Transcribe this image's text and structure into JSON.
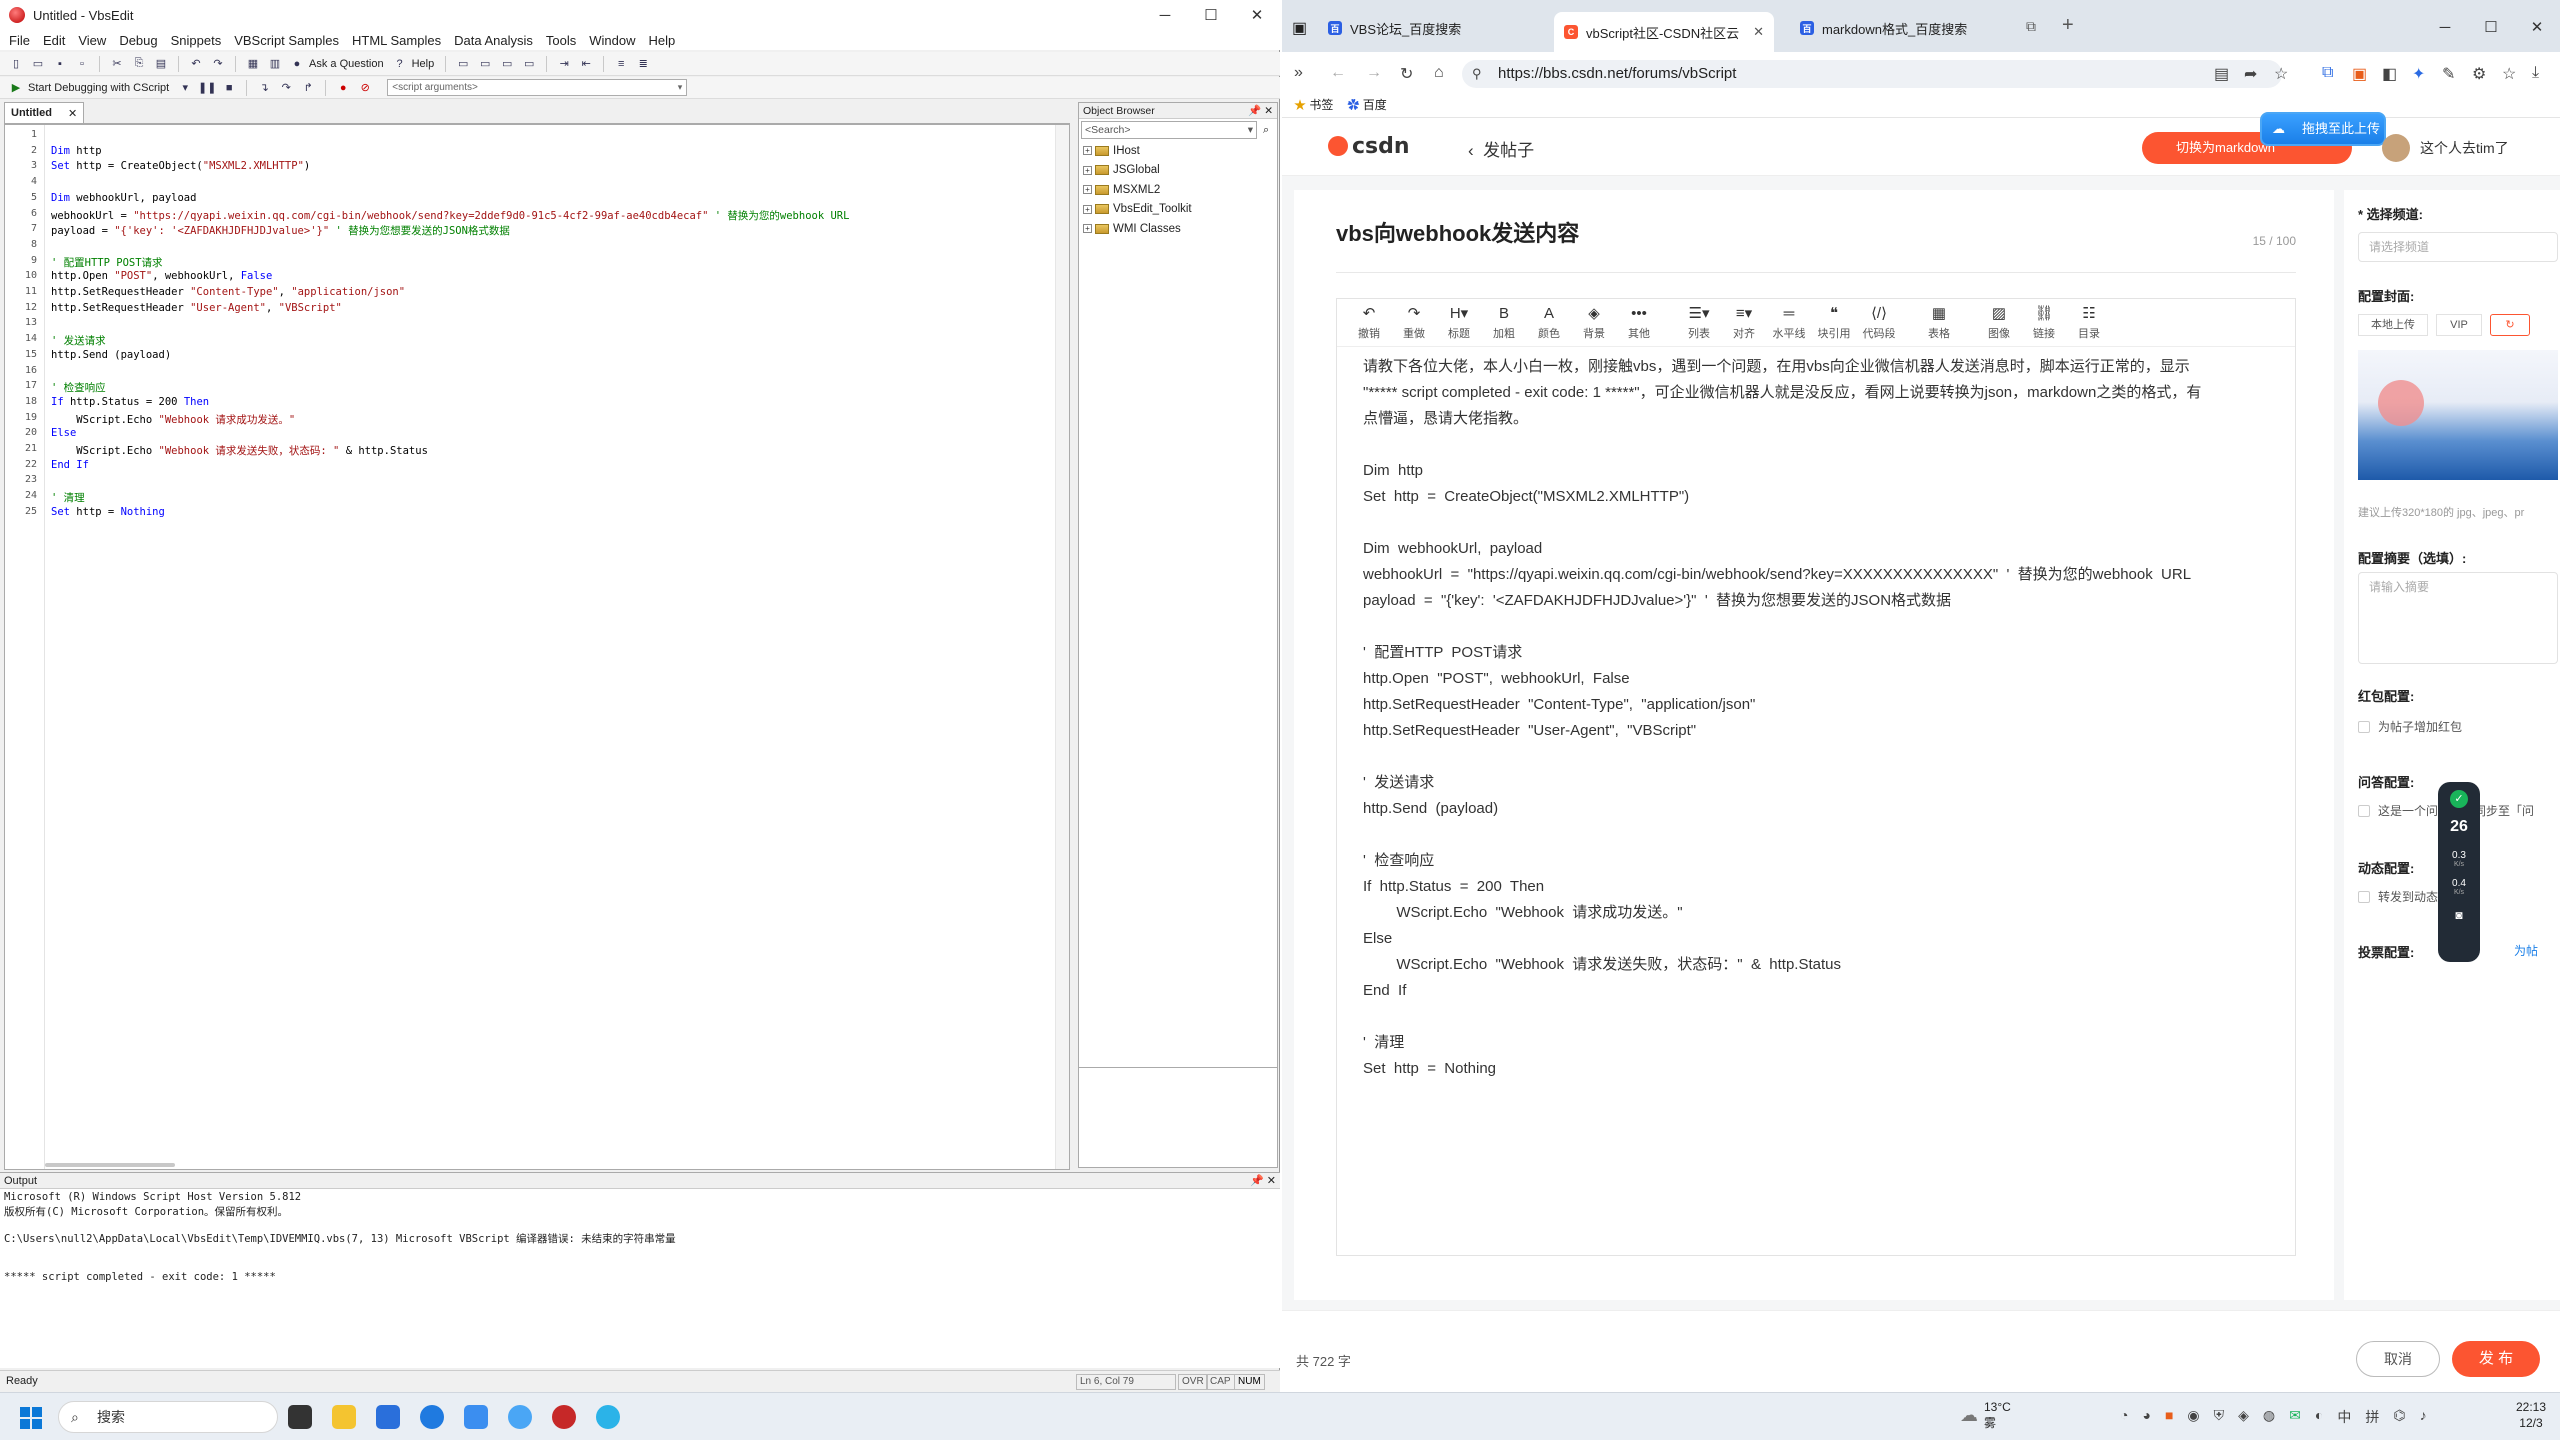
{
  "vbsedit": {
    "window_title": "Untitled - VbsEdit",
    "menu": [
      "File",
      "Edit",
      "View",
      "Debug",
      "Snippets",
      "VBScript Samples",
      "HTML Samples",
      "Data Analysis",
      "Tools",
      "Window",
      "Help"
    ],
    "toolbar": {
      "ask": "Ask a Question",
      "help": "Help",
      "debug": "Start Debugging with CScript",
      "args_placeholder": "<script arguments>"
    },
    "doc_tab": "Untitled",
    "code_lines": [
      "",
      "Dim http",
      "Set http = CreateObject(\"MSXML2.XMLHTTP\")",
      "",
      "Dim webhookUrl, payload",
      "webhookUrl = \"https://qyapi.weixin.qq.com/cgi-bin/webhook/send?key=2ddef9d0-91c5-4cf2-99af-ae40cdb4ecaf\" ' 替换为您的webhook URL",
      "payload = \"{'key': '<ZAFDAKHJDFHJDJvalue>'}\" ' 替换为您想要发送的JSON格式数据",
      "",
      "' 配置HTTP POST请求",
      "http.Open \"POST\", webhookUrl, False",
      "http.SetRequestHeader \"Content-Type\", \"application/json\"",
      "http.SetRequestHeader \"User-Agent\", \"VBScript\"",
      "",
      "' 发送请求",
      "http.Send (payload)",
      "",
      "' 检查响应",
      "If http.Status = 200 Then",
      "    WScript.Echo \"Webhook 请求成功发送。\"",
      "Else",
      "    WScript.Echo \"Webhook 请求发送失败，状态码: \" & http.Status",
      "End If",
      "",
      "' 清理",
      "Set http = Nothing"
    ],
    "object_browser": {
      "title": "Object Browser",
      "search": "<Search>",
      "items": [
        "IHost",
        "JSGlobal",
        "MSXML2",
        "VbsEdit_Toolkit",
        "WMI Classes"
      ]
    },
    "output": {
      "title": "Output",
      "lines": [
        "Microsoft (R) Windows Script Host Version 5.812",
        "版权所有(C) Microsoft Corporation。保留所有权利。",
        "",
        "C:\\Users\\null2\\AppData\\Local\\VbsEdit\\Temp\\IDVEMMIQ.vbs(7, 13) Microsoft VBScript 编译器错误: 未结束的字符串常量",
        "",
        "",
        "***** script completed - exit code: 1 *****"
      ]
    },
    "status": {
      "left": "Ready",
      "pos": "Ln 6, Col 79",
      "ovr": "OVR",
      "cap": "CAP",
      "num": "NUM"
    }
  },
  "browser": {
    "tabs": [
      {
        "title": "VBS论坛_百度搜索",
        "color": "#2b5fe3"
      },
      {
        "title": "vbScript社区-CSDN社区云",
        "color": "#fc5531"
      },
      {
        "title": "markdown格式_百度搜索",
        "color": "#2b5fe3"
      }
    ],
    "url": "https://bbs.csdn.net/forums/vbScript",
    "bookmarks": [
      "书签",
      "百度"
    ],
    "header": {
      "logo": "csdn",
      "back_title": "发帖子",
      "switch_md": "切换为markdown",
      "drag_upload": "拖拽至此上传",
      "username": "这个人去tim了"
    },
    "post": {
      "title": "vbs向webhook发送内容",
      "title_count": "15 / 100",
      "tools": [
        "撤销",
        "重做",
        "标题",
        "加粗",
        "颜色",
        "背景",
        "其他",
        "列表",
        "对齐",
        "水平线",
        "块引用",
        "代码段",
        "表格",
        "图像",
        "链接",
        "目录"
      ],
      "body": [
        "请教下各位大佬，本人小白一枚，刚接触vbs，遇到一个问题，在用vbs向企业微信机器人发送消息时，脚本运行正常的，显示",
        "\"***** script completed - exit code: 1 *****\"，可企业微信机器人就是没反应，看网上说要转换为json，markdown之类的格式，有",
        "点懵逼，恳请大佬指教。",
        "",
        "Dim  http",
        "Set  http  =  CreateObject(\"MSXML2.XMLHTTP\")",
        "",
        "Dim  webhookUrl,  payload",
        "webhookUrl  =  \"https://qyapi.weixin.qq.com/cgi-bin/webhook/send?key=XXXXXXXXXXXXXXX\"  '  替换为您的webhook  URL",
        "payload  =  \"{'key':  '<ZAFDAKHJDFHJDJvalue>'}\"  '  替换为您想要发送的JSON格式数据",
        "",
        "'  配置HTTP  POST请求",
        "http.Open  \"POST\",  webhookUrl,  False",
        "http.SetRequestHeader  \"Content-Type\",  \"application/json\"",
        "http.SetRequestHeader  \"User-Agent\",  \"VBScript\"",
        "",
        "'  发送请求",
        "http.Send  (payload)",
        "",
        "'  检查响应",
        "If  http.Status  =  200  Then",
        "        WScript.Echo  \"Webhook  请求成功发送。\"",
        "Else",
        "        WScript.Echo  \"Webhook  请求发送失败，状态码：\"  &  http.Status",
        "End  If",
        "",
        "'  清理",
        "Set  http  =  Nothing"
      ]
    },
    "sidebar": {
      "channel_label": "* 选择频道:",
      "channel_placeholder": "请选择频道",
      "cover_label": "配置封面:",
      "cover_local": "本地上传",
      "cover_vip": "VIP",
      "cover_hint": "建议上传320*180的 jpg、jpeg、pr",
      "summary_label": "配置摘要（选填）:",
      "summary_placeholder": "请输入摘要",
      "redpacket_label": "红包配置:",
      "redpacket_chk": "为帖子增加红包",
      "qa_label": "问答配置:",
      "qa_chk": "这是一个问答帖，同步至「问",
      "dynamic_label": "动态配置:",
      "dynamic_chk": "转发到动态",
      "vote_label": "投票配置:",
      "vote_link": "为帖"
    },
    "speed_widget": {
      "value": "26",
      "up": "0.3",
      "down": "0.4",
      "unit": "K/s"
    },
    "footer": {
      "word_count": "共 722 字",
      "cancel": "取消",
      "publish": "发 布"
    }
  },
  "taskbar": {
    "search": "搜索",
    "weather": "13°C",
    "weather_desc": "雾",
    "ime": "中",
    "ime2": "拼",
    "time": "22:13",
    "date": "12/3"
  }
}
